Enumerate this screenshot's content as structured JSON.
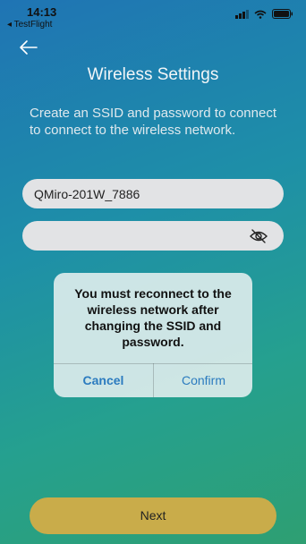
{
  "status_bar": {
    "time": "14:13",
    "back_app": "◂ TestFlight"
  },
  "header": {
    "title": "Wireless Settings"
  },
  "description": "Create an SSID and password to connect to connect to the wireless network.",
  "form": {
    "ssid_value": "QMiro-201W_7886",
    "password_value": ""
  },
  "dialog": {
    "message": "You must reconnect to the wireless network after changing the SSID and password.",
    "cancel_label": "Cancel",
    "confirm_label": "Confirm"
  },
  "footer": {
    "next_label": "Next"
  },
  "colors": {
    "accent": "#2b7bbf",
    "next_button": "#c9ac4a"
  }
}
